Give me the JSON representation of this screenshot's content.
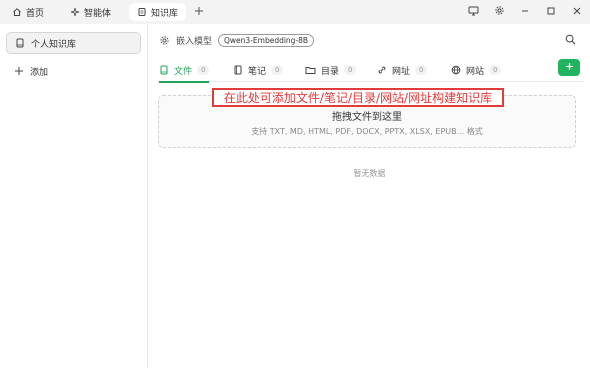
{
  "titlebar": {
    "tabs": [
      {
        "label": "首页",
        "icon": "home-icon",
        "active": false
      },
      {
        "label": "智能体",
        "icon": "agent-icon",
        "active": false
      },
      {
        "label": "知识库",
        "icon": "knowledge-icon",
        "active": true
      }
    ],
    "add_icon": "plus-icon",
    "controls": [
      "monitor-icon",
      "gear-icon",
      "minimize-icon",
      "maximize-icon",
      "close-icon"
    ]
  },
  "sidebar": {
    "items": [
      {
        "label": "个人知识库",
        "icon": "book-icon",
        "selected": true
      }
    ],
    "add_label": "添加"
  },
  "main": {
    "embed_label": "嵌入模型",
    "embed_model": "Qwen3-Embedding-8B",
    "tabs": [
      {
        "label": "文件",
        "count": "0",
        "icon": "file-icon",
        "active": true
      },
      {
        "label": "笔记",
        "count": "0",
        "icon": "notebook-icon",
        "active": false
      },
      {
        "label": "目录",
        "count": "0",
        "icon": "folder-icon",
        "active": false
      },
      {
        "label": "网址",
        "count": "0",
        "icon": "link-icon",
        "active": false
      },
      {
        "label": "网站",
        "count": "0",
        "icon": "globe-icon",
        "active": false
      }
    ],
    "dropzone": {
      "title": "拖拽文件到这里",
      "subtitle": "支持 TXT, MD, HTML, PDF, DOCX, PPTX, XLSX, EPUB... 格式"
    },
    "empty_text": "暂无数据",
    "annotation": "在此处可添加文件/笔记/目录/网站/网址构建知识库"
  },
  "colors": {
    "accent": "#22b35e",
    "annotation": "#e03c3c"
  }
}
